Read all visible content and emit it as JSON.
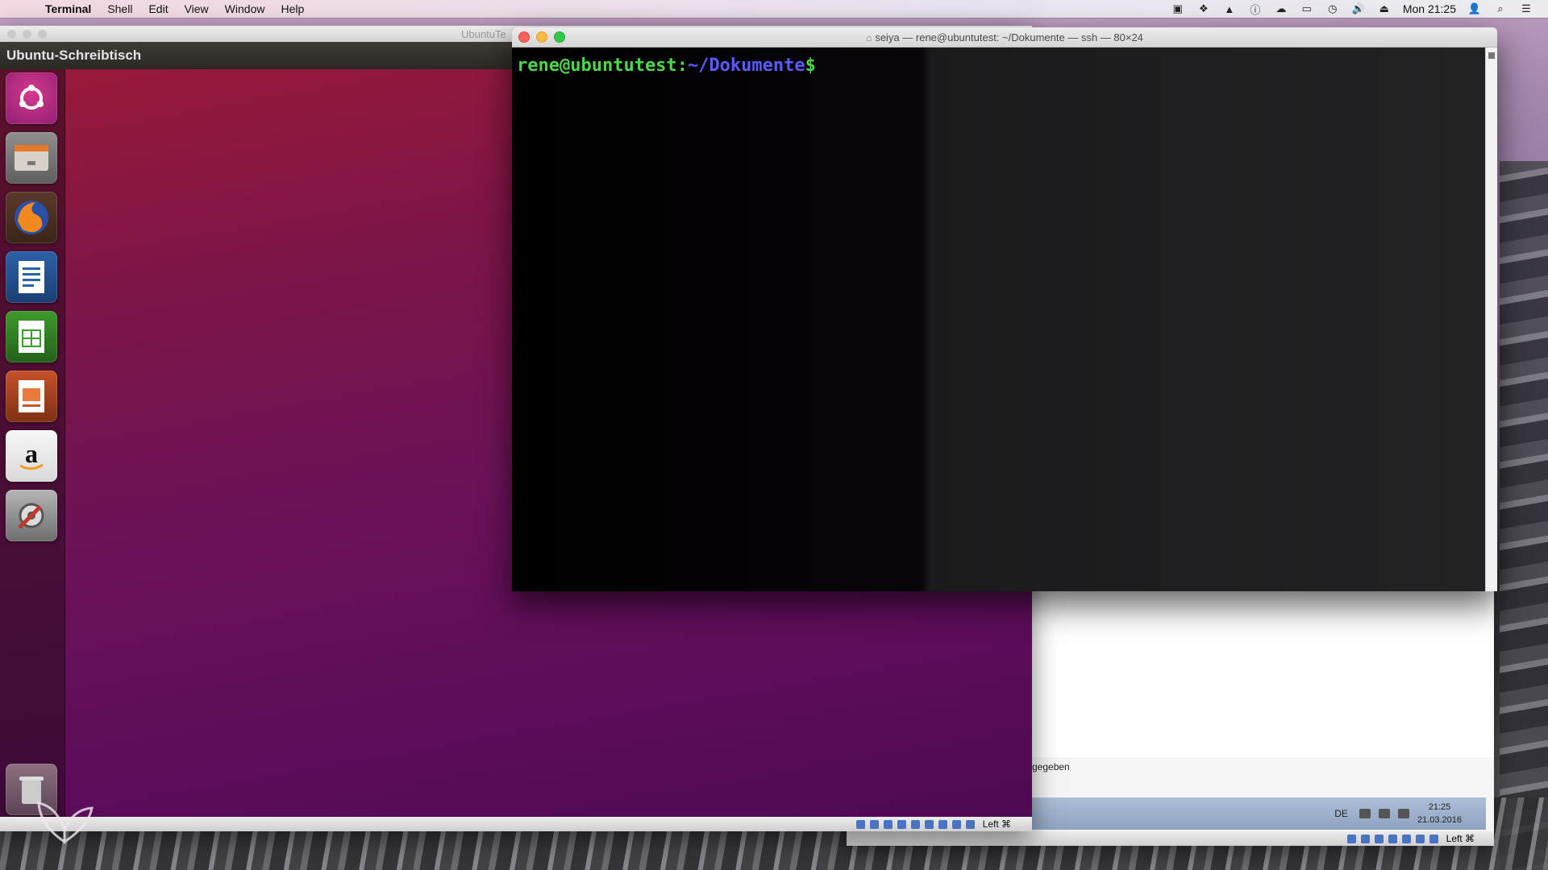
{
  "menubar": {
    "apple_icon": "apple-icon",
    "app_name": "Terminal",
    "items": [
      "Shell",
      "Edit",
      "View",
      "Window",
      "Help"
    ],
    "clock": "Mon 21:25"
  },
  "vm_window": {
    "title": "UbuntuTe",
    "desktop_title": "Ubuntu-Schreibtisch",
    "launcher": [
      {
        "name": "dash-home-icon"
      },
      {
        "name": "files-icon"
      },
      {
        "name": "firefox-icon"
      },
      {
        "name": "libreoffice-writer-icon"
      },
      {
        "name": "libreoffice-calc-icon"
      },
      {
        "name": "libreoffice-impress-icon"
      },
      {
        "name": "amazon-icon"
      },
      {
        "name": "system-settings-icon"
      },
      {
        "name": "trash-icon"
      }
    ],
    "host_key": "Left ⌘"
  },
  "terminal": {
    "title": "seiya — rene@ubuntutest: ~/Dokumente — ssh — 80×24",
    "prompt_user": "rene@ubuntutest",
    "prompt_sep": ":",
    "prompt_path": "~/Dokumente",
    "prompt_sign": "$"
  },
  "win_window": {
    "text_fragment": "gegeben",
    "language": "DE",
    "time": "21:25",
    "date": "21.03.2016",
    "host_key": "Left ⌘"
  },
  "colors": {
    "prompt_green": "#4bd84b",
    "prompt_blue": "#5a5aff",
    "ubuntu_purple": "#6a1258"
  }
}
